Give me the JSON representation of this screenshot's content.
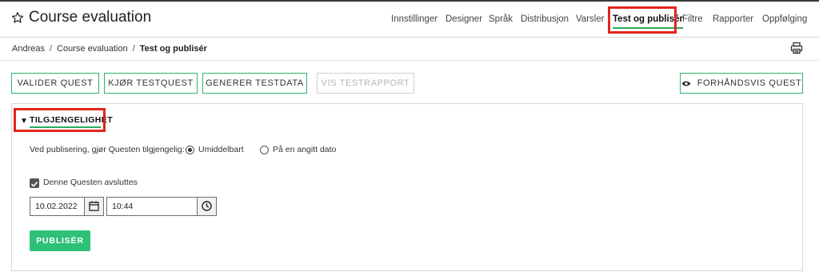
{
  "header": {
    "title": "Course evaluation",
    "nav": [
      {
        "label": "Innstillinger"
      },
      {
        "label": "Designer"
      },
      {
        "label": "Språk"
      },
      {
        "label": "Distribusjon"
      },
      {
        "label": "Varsler"
      },
      {
        "label": "Test og publisér",
        "active": true
      },
      {
        "label": "Filtre"
      },
      {
        "label": "Rapporter"
      },
      {
        "label": "Oppfølging"
      }
    ]
  },
  "breadcrumb": {
    "items": [
      "Andreas",
      "Course evaluation"
    ],
    "current": "Test og publisér"
  },
  "toolbar": {
    "validate": "VALIDER QUEST",
    "run_test": "KJØR TESTQUEST",
    "generate_data": "GENERER TESTDATA",
    "show_report": "VIS TESTRAPPORT",
    "preview": "FORHÅNDSVIS QUEST"
  },
  "availability": {
    "section_title": "TILGJENGELIGHET",
    "publish_prompt": "Ved publisering, gjør Questen tilgjengelig:",
    "option_immediately": "Umiddelbart",
    "option_date": "På en angitt dato",
    "selected": "Umiddelbart",
    "ends_label": "Denne Questen avsluttes",
    "ends_checked": true,
    "end_date": "10.02.2022",
    "end_time": "10:44",
    "publish_button": "PUBLISÉR"
  },
  "icons": {
    "star": "star-icon",
    "print": "print-icon",
    "eye": "eye-icon",
    "calendar": "calendar-icon",
    "clock": "clock-icon",
    "toggle": "triangle-down-icon"
  },
  "colors": {
    "accent": "#27ae60",
    "publish_button": "#2dc177",
    "highlight_box": "#e3261c"
  }
}
